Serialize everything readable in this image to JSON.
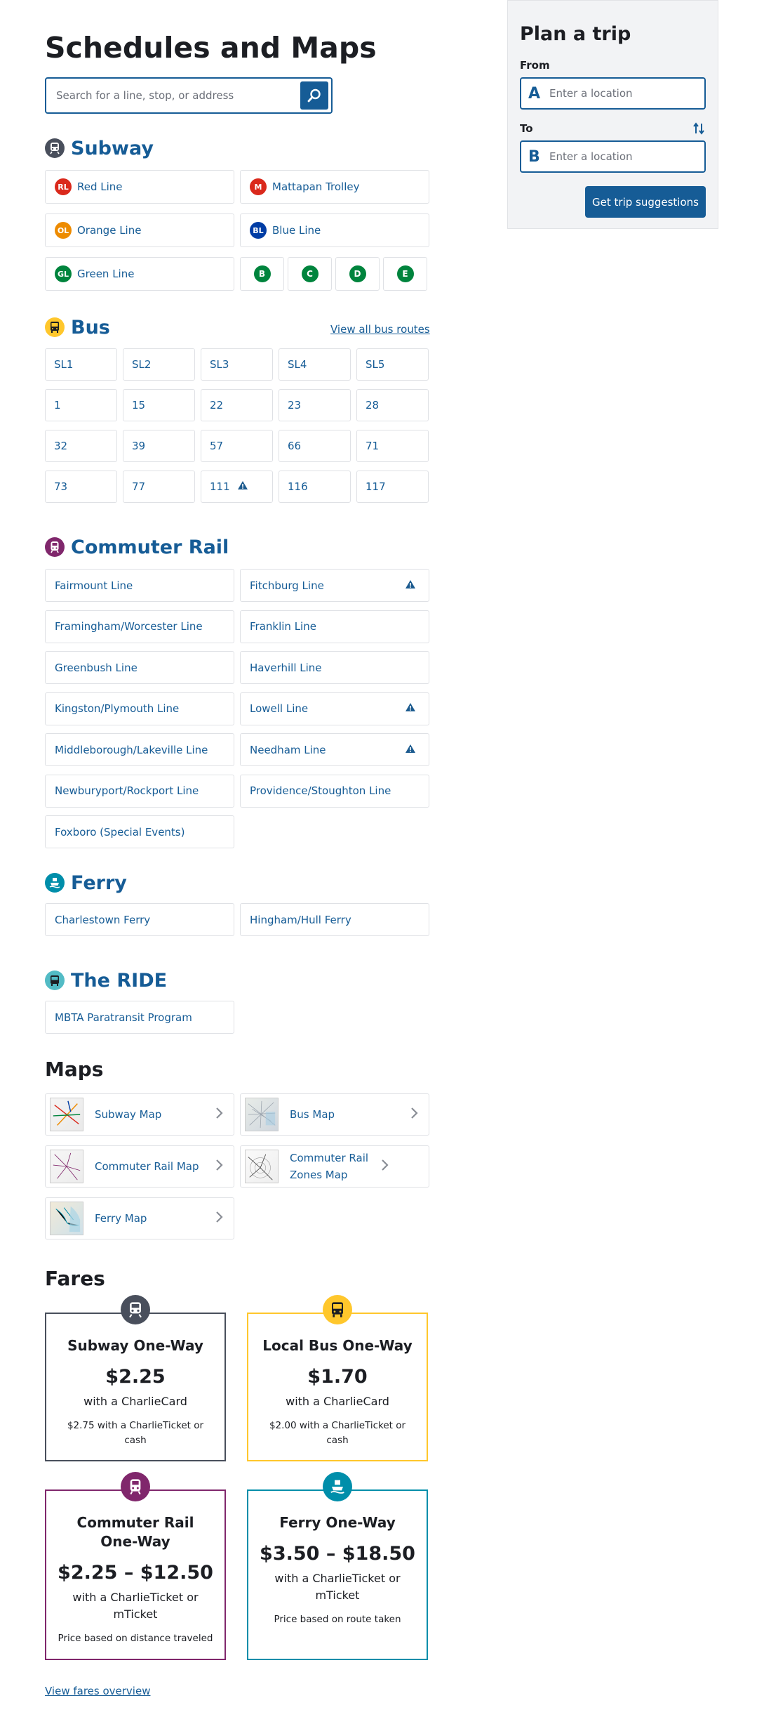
{
  "title": "Schedules and Maps",
  "search": {
    "placeholder": "Search for a line, stop, or address"
  },
  "subway": {
    "heading": "Subway",
    "lines": [
      {
        "badge": "RL",
        "label": "Red Line",
        "color": "#da291c"
      },
      {
        "badge": "M",
        "label": "Mattapan Trolley",
        "color": "#da291c"
      },
      {
        "badge": "OL",
        "label": "Orange Line",
        "color": "#ed8b00"
      },
      {
        "badge": "BL",
        "label": "Blue Line",
        "color": "#003da5"
      },
      {
        "badge": "GL",
        "label": "Green Line",
        "color": "#00843d"
      }
    ],
    "branches": [
      "B",
      "C",
      "D",
      "E"
    ]
  },
  "bus": {
    "heading": "Bus",
    "view_all": "View all bus routes",
    "routes": [
      "SL1",
      "SL2",
      "SL3",
      "SL4",
      "SL5",
      "1",
      "15",
      "22",
      "23",
      "28",
      "32",
      "39",
      "57",
      "66",
      "71",
      "73",
      "77",
      "111",
      "116",
      "117"
    ],
    "alert_routes": [
      "111"
    ]
  },
  "commuter_rail": {
    "heading": "Commuter Rail",
    "lines": [
      {
        "label": "Fairmount Line",
        "alert": false
      },
      {
        "label": "Fitchburg Line",
        "alert": true
      },
      {
        "label": "Framingham/Worcester Line",
        "alert": false
      },
      {
        "label": "Franklin Line",
        "alert": false
      },
      {
        "label": "Greenbush Line",
        "alert": false
      },
      {
        "label": "Haverhill Line",
        "alert": false
      },
      {
        "label": "Kingston/Plymouth Line",
        "alert": false
      },
      {
        "label": "Lowell Line",
        "alert": true
      },
      {
        "label": "Middleborough/Lakeville Line",
        "alert": false
      },
      {
        "label": "Needham Line",
        "alert": true
      },
      {
        "label": "Newburyport/Rockport Line",
        "alert": false
      },
      {
        "label": "Providence/Stoughton Line",
        "alert": false
      },
      {
        "label": "Foxboro (Special Events)",
        "alert": false
      }
    ]
  },
  "ferry": {
    "heading": "Ferry",
    "lines": [
      "Charlestown Ferry",
      "Hingham/Hull Ferry"
    ]
  },
  "ride": {
    "heading": "The RIDE",
    "lines": [
      "MBTA Paratransit Program"
    ]
  },
  "maps": {
    "heading": "Maps",
    "items": [
      "Subway Map",
      "Bus Map",
      "Commuter Rail Map",
      "Commuter Rail Zones Map",
      "Ferry Map"
    ]
  },
  "fares": {
    "heading": "Fares",
    "cards": [
      {
        "title": "Subway One-Way",
        "price": "$2.25",
        "with": "with a CharlieCard",
        "note": "$2.75 with a CharlieTicket or cash",
        "color": "#494f5c"
      },
      {
        "title": "Local Bus One-Way",
        "price": "$1.70",
        "with": "with a CharlieCard",
        "note": "$2.00 with a CharlieTicket or cash",
        "color": "#ffc72c"
      },
      {
        "title": "Commuter Rail One-Way",
        "price": "$2.25 – $12.50",
        "with": "with a CharlieTicket or mTicket",
        "note": "Price based on distance traveled",
        "color": "#80276c"
      },
      {
        "title": "Ferry One-Way",
        "price": "$3.50 – $18.50",
        "with": "with a CharlieTicket or mTicket",
        "note": "Price based on route taken",
        "color": "#008eaa"
      }
    ],
    "overview": "View fares overview"
  },
  "planner": {
    "heading": "Plan a trip",
    "from_label": "From",
    "to_label": "To",
    "from_badge": "A",
    "to_badge": "B",
    "placeholder": "Enter a location",
    "button": "Get trip suggestions"
  },
  "colors": {
    "link": "#165c96",
    "subway": "#494f5c",
    "bus": "#ffc72c",
    "commuter_rail": "#80276c",
    "ferry": "#008eaa",
    "ride": "#52bbc5"
  }
}
